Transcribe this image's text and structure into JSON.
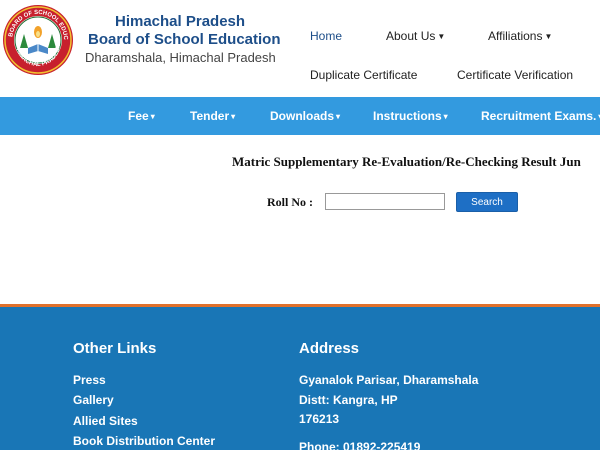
{
  "header": {
    "org_line1": "Himachal Pradesh",
    "org_line2": "Board of School Education",
    "org_line3": "Dharamshala, Himachal Pradesh",
    "logo_text": "BOARD OF SCHOOL EDUCATION · HIMACHAL PRADESH"
  },
  "top_nav": {
    "home": "Home",
    "about": "About Us",
    "affiliations": "Affiliations",
    "duplicate_certificate": "Duplicate Certificate",
    "certificate_verification": "Certificate Verification"
  },
  "menu": {
    "fee": "Fee",
    "tender": "Tender",
    "downloads": "Downloads",
    "instructions": "Instructions",
    "recruitment": "Recruitment Exams."
  },
  "main": {
    "title": "Matric Supplementary Re-Evaluation/Re-Checking Result Jun",
    "roll_label": "Roll No :",
    "roll_value": "",
    "search_label": "Search"
  },
  "footer": {
    "links_heading": "Other Links",
    "links": [
      "Press",
      "Gallery",
      "Allied Sites",
      "Book Distribution Center"
    ],
    "address_heading": "Address",
    "address_lines": [
      "Gyanalok Parisar, Dharamshala",
      "Distt: Kangra, HP",
      "176213",
      "Phone: 01892-225419"
    ]
  },
  "colors": {
    "brand_blue": "#1d4e89",
    "menu_bar": "#339adf",
    "footer_bg": "#1976b6",
    "footer_rule": "#e0712c",
    "button": "#1e6fc5"
  },
  "icons": {
    "logo": "board-seal-icon",
    "dropdown": "caret-down-icon"
  }
}
